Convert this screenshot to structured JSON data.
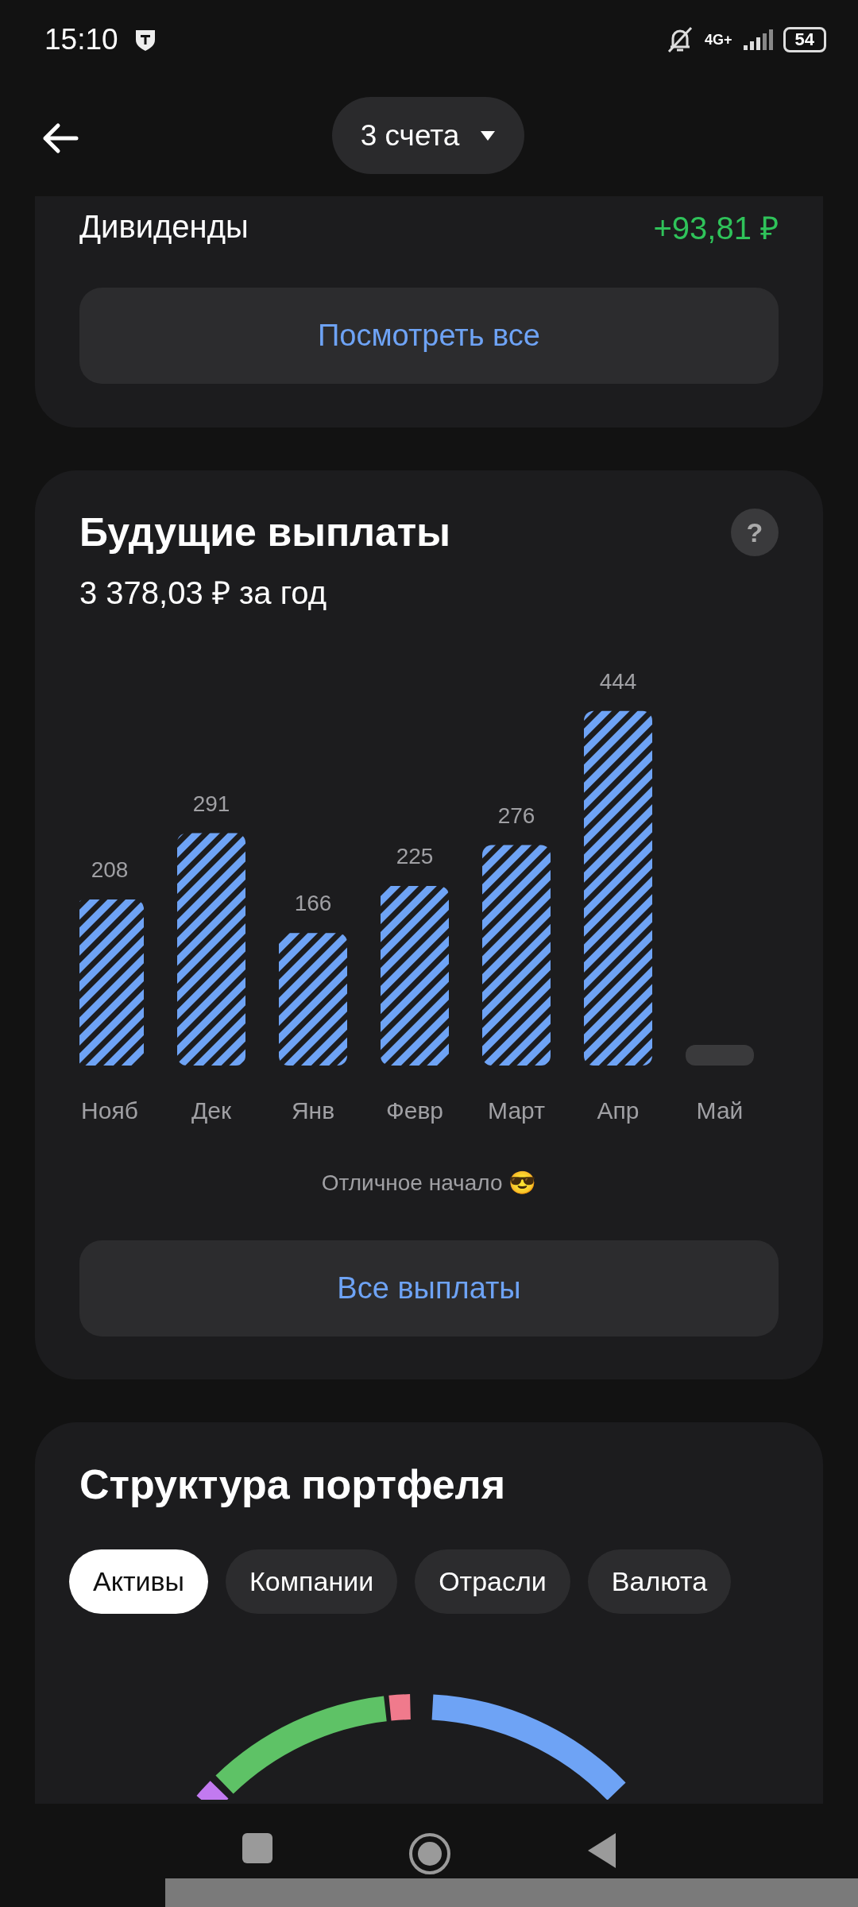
{
  "status_bar": {
    "time": "15:10",
    "network": "4G+",
    "battery": "54"
  },
  "header": {
    "account_selector": "3 счета"
  },
  "dividends": {
    "label": "Дивиденды",
    "value": "+93,81 ₽",
    "button": "Посмотреть все"
  },
  "future_payouts": {
    "title": "Будущие выплаты",
    "help": "?",
    "subtitle": "3 378,03 ₽ за год",
    "chart_data": {
      "type": "bar",
      "categories": [
        "Нояб",
        "Дек",
        "Янв",
        "Февр",
        "Март",
        "Апр",
        "Май"
      ],
      "values": [
        208,
        291,
        166,
        225,
        276,
        444,
        null
      ],
      "data_labels": true
    },
    "note": "Отличное начало 😎",
    "button": "Все выплаты"
  },
  "portfolio_structure": {
    "title": "Структура портфеля",
    "tabs": [
      {
        "label": "Активы",
        "selected": true
      },
      {
        "label": "Компании",
        "selected": false
      },
      {
        "label": "Отрасли",
        "selected": false
      },
      {
        "label": "Валюта",
        "selected": false
      }
    ]
  }
}
